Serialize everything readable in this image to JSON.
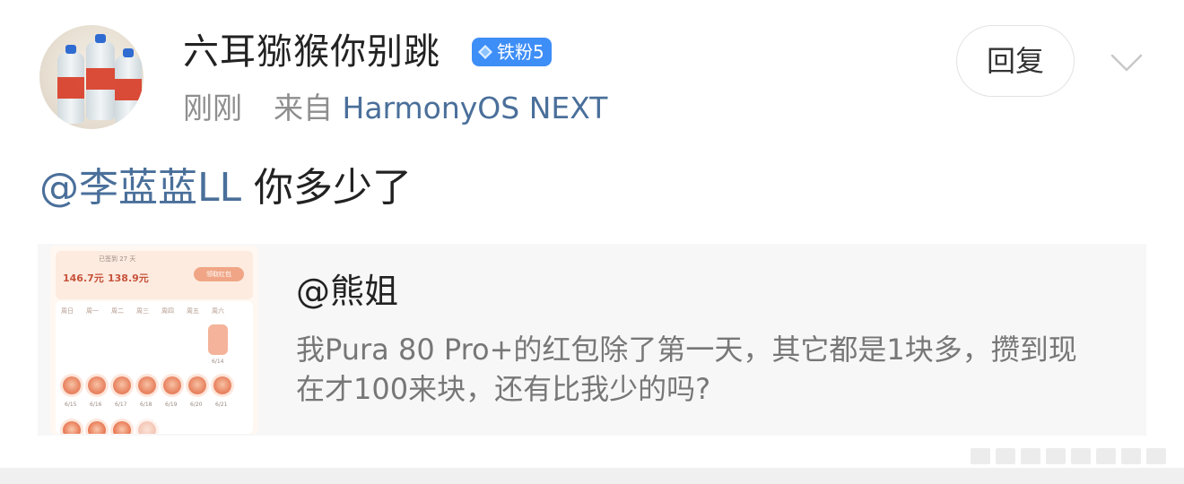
{
  "post": {
    "username": "六耳猕猴你别跳",
    "badge_label": "铁粉5",
    "time": "刚刚",
    "source_prefix": "来自",
    "source_app": "HarmonyOS NEXT",
    "reply_label": "回复",
    "comment_mention": "@李蓝蓝LL",
    "comment_text": "你多少了"
  },
  "quote": {
    "author": "@熊姐",
    "text_line1": "我Pura 80 Pro+的红包除了第一天，其它都是1块多，攒到现",
    "text_line2": "在才100来块，还有比我少的吗?",
    "thumbnail": {
      "streak": "已签到 27 天",
      "amount1": "146.7元",
      "amount2": "138.9元",
      "action": "领取红包",
      "weekdays": [
        "周日",
        "周一",
        "周二",
        "周三",
        "周四",
        "周五",
        "周六"
      ],
      "first_day": "6/14",
      "week2_dates": [
        "6/15",
        "6/16",
        "6/17",
        "6/18",
        "6/19",
        "6/20",
        "6/21"
      ]
    }
  },
  "colors": {
    "accent_link": "#4a6f9a",
    "badge_bg": "#3e8ef7",
    "muted_text": "#8e8e8e"
  },
  "icons": {
    "badge": "diamond-icon",
    "expand": "chevron-down-icon"
  }
}
